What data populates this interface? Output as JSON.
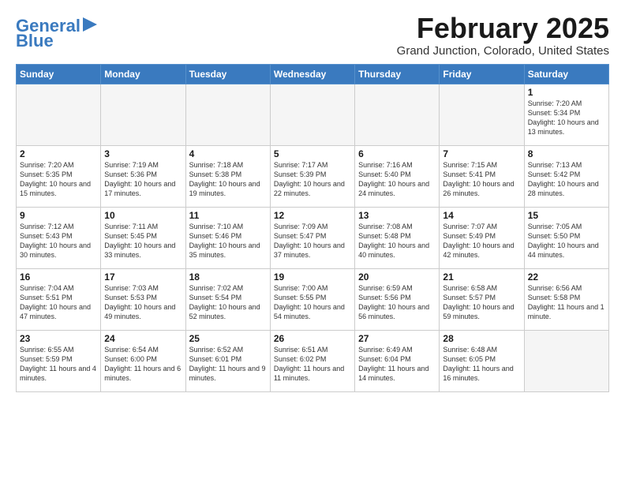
{
  "header": {
    "logo_line1": "General",
    "logo_line2": "Blue",
    "month_title": "February 2025",
    "location": "Grand Junction, Colorado, United States"
  },
  "days_of_week": [
    "Sunday",
    "Monday",
    "Tuesday",
    "Wednesday",
    "Thursday",
    "Friday",
    "Saturday"
  ],
  "weeks": [
    [
      {
        "num": "",
        "info": ""
      },
      {
        "num": "",
        "info": ""
      },
      {
        "num": "",
        "info": ""
      },
      {
        "num": "",
        "info": ""
      },
      {
        "num": "",
        "info": ""
      },
      {
        "num": "",
        "info": ""
      },
      {
        "num": "1",
        "info": "Sunrise: 7:20 AM\nSunset: 5:34 PM\nDaylight: 10 hours\nand 13 minutes."
      }
    ],
    [
      {
        "num": "2",
        "info": "Sunrise: 7:20 AM\nSunset: 5:35 PM\nDaylight: 10 hours\nand 15 minutes."
      },
      {
        "num": "3",
        "info": "Sunrise: 7:19 AM\nSunset: 5:36 PM\nDaylight: 10 hours\nand 17 minutes."
      },
      {
        "num": "4",
        "info": "Sunrise: 7:18 AM\nSunset: 5:38 PM\nDaylight: 10 hours\nand 19 minutes."
      },
      {
        "num": "5",
        "info": "Sunrise: 7:17 AM\nSunset: 5:39 PM\nDaylight: 10 hours\nand 22 minutes."
      },
      {
        "num": "6",
        "info": "Sunrise: 7:16 AM\nSunset: 5:40 PM\nDaylight: 10 hours\nand 24 minutes."
      },
      {
        "num": "7",
        "info": "Sunrise: 7:15 AM\nSunset: 5:41 PM\nDaylight: 10 hours\nand 26 minutes."
      },
      {
        "num": "8",
        "info": "Sunrise: 7:13 AM\nSunset: 5:42 PM\nDaylight: 10 hours\nand 28 minutes."
      }
    ],
    [
      {
        "num": "9",
        "info": "Sunrise: 7:12 AM\nSunset: 5:43 PM\nDaylight: 10 hours\nand 30 minutes."
      },
      {
        "num": "10",
        "info": "Sunrise: 7:11 AM\nSunset: 5:45 PM\nDaylight: 10 hours\nand 33 minutes."
      },
      {
        "num": "11",
        "info": "Sunrise: 7:10 AM\nSunset: 5:46 PM\nDaylight: 10 hours\nand 35 minutes."
      },
      {
        "num": "12",
        "info": "Sunrise: 7:09 AM\nSunset: 5:47 PM\nDaylight: 10 hours\nand 37 minutes."
      },
      {
        "num": "13",
        "info": "Sunrise: 7:08 AM\nSunset: 5:48 PM\nDaylight: 10 hours\nand 40 minutes."
      },
      {
        "num": "14",
        "info": "Sunrise: 7:07 AM\nSunset: 5:49 PM\nDaylight: 10 hours\nand 42 minutes."
      },
      {
        "num": "15",
        "info": "Sunrise: 7:05 AM\nSunset: 5:50 PM\nDaylight: 10 hours\nand 44 minutes."
      }
    ],
    [
      {
        "num": "16",
        "info": "Sunrise: 7:04 AM\nSunset: 5:51 PM\nDaylight: 10 hours\nand 47 minutes."
      },
      {
        "num": "17",
        "info": "Sunrise: 7:03 AM\nSunset: 5:53 PM\nDaylight: 10 hours\nand 49 minutes."
      },
      {
        "num": "18",
        "info": "Sunrise: 7:02 AM\nSunset: 5:54 PM\nDaylight: 10 hours\nand 52 minutes."
      },
      {
        "num": "19",
        "info": "Sunrise: 7:00 AM\nSunset: 5:55 PM\nDaylight: 10 hours\nand 54 minutes."
      },
      {
        "num": "20",
        "info": "Sunrise: 6:59 AM\nSunset: 5:56 PM\nDaylight: 10 hours\nand 56 minutes."
      },
      {
        "num": "21",
        "info": "Sunrise: 6:58 AM\nSunset: 5:57 PM\nDaylight: 10 hours\nand 59 minutes."
      },
      {
        "num": "22",
        "info": "Sunrise: 6:56 AM\nSunset: 5:58 PM\nDaylight: 11 hours\nand 1 minute."
      }
    ],
    [
      {
        "num": "23",
        "info": "Sunrise: 6:55 AM\nSunset: 5:59 PM\nDaylight: 11 hours\nand 4 minutes."
      },
      {
        "num": "24",
        "info": "Sunrise: 6:54 AM\nSunset: 6:00 PM\nDaylight: 11 hours\nand 6 minutes."
      },
      {
        "num": "25",
        "info": "Sunrise: 6:52 AM\nSunset: 6:01 PM\nDaylight: 11 hours\nand 9 minutes."
      },
      {
        "num": "26",
        "info": "Sunrise: 6:51 AM\nSunset: 6:02 PM\nDaylight: 11 hours\nand 11 minutes."
      },
      {
        "num": "27",
        "info": "Sunrise: 6:49 AM\nSunset: 6:04 PM\nDaylight: 11 hours\nand 14 minutes."
      },
      {
        "num": "28",
        "info": "Sunrise: 6:48 AM\nSunset: 6:05 PM\nDaylight: 11 hours\nand 16 minutes."
      },
      {
        "num": "",
        "info": ""
      }
    ]
  ]
}
